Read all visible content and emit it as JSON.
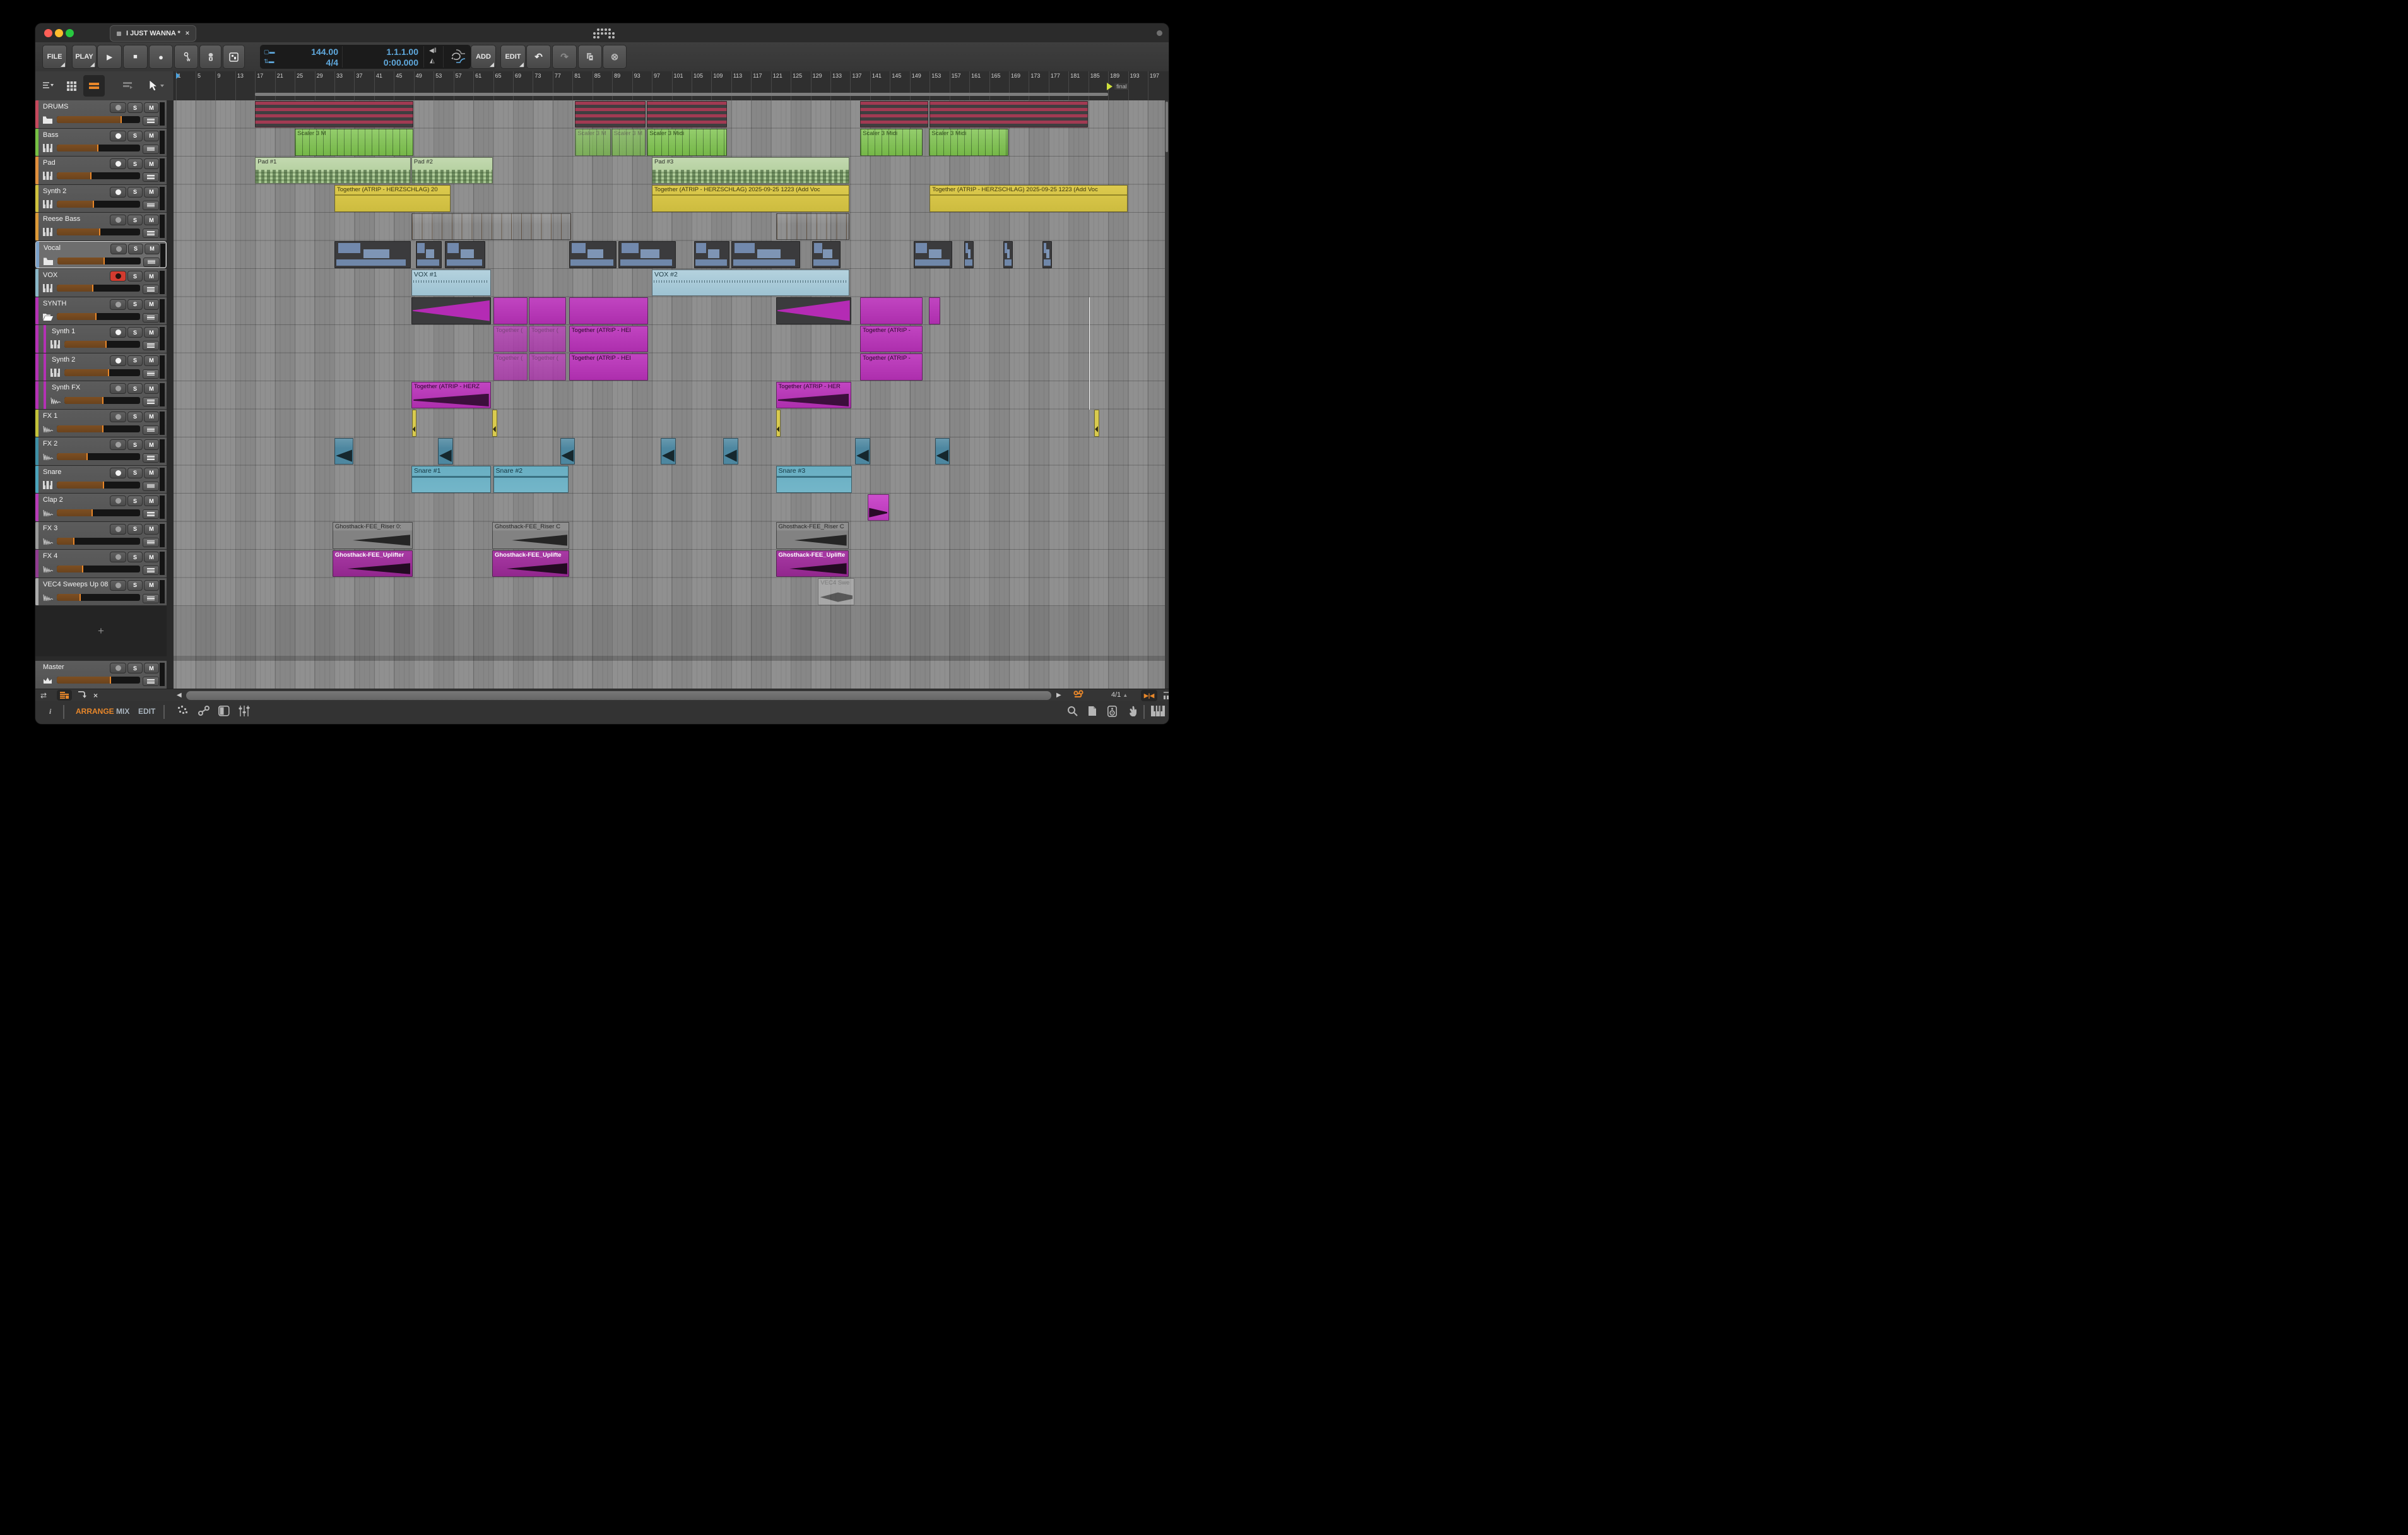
{
  "window": {
    "title": "I JUST WANNA *",
    "close_glyph": "×"
  },
  "transport": {
    "file": "FILE",
    "play": "PLAY",
    "add": "ADD",
    "edit": "EDIT",
    "tempo": "144.00",
    "time_signature": "4/4",
    "position": "1.1.1.00",
    "time": "0:00.000",
    "icon_buttons": [
      "play-icon",
      "stop-icon",
      "record-icon",
      "automation-write-icon",
      "metronome-icon",
      "punch-icon",
      "undo-icon",
      "redo-icon",
      "duplicate-icon",
      "delete-icon",
      "loop-icon"
    ]
  },
  "header_tools": {
    "icons": [
      "track-list-icon",
      "grid-view-icon",
      "arrange-lanes-icon",
      "layers-icon",
      "pointer-tool-icon"
    ]
  },
  "ruler": {
    "numbers": [
      1,
      5,
      9,
      13,
      17,
      21,
      25,
      29,
      33,
      37,
      41,
      45,
      49,
      53,
      57,
      61,
      65,
      69,
      73,
      77,
      81,
      85,
      89,
      93,
      97,
      101,
      105,
      109,
      113,
      117,
      121,
      125,
      129,
      133,
      137,
      141,
      145,
      149,
      153,
      157,
      161,
      165,
      169,
      173,
      177,
      181,
      185,
      189,
      193,
      197
    ],
    "marker": {
      "bar": 189,
      "label": "final"
    },
    "loop": {
      "from": 17,
      "to": 189
    },
    "playhead_bar": 1
  },
  "tracks": [
    {
      "name": "DRUMS",
      "color": "#c4485c",
      "icon": "folder",
      "rec": "off",
      "vol": 0.78
    },
    {
      "name": "Bass",
      "color": "#76c043",
      "icon": "keys",
      "rec": "on",
      "vol": 0.5
    },
    {
      "name": "Pad",
      "color": "#e08f3c",
      "icon": "keys",
      "rec": "on",
      "vol": 0.42
    },
    {
      "name": "Synth 2",
      "color": "#cfc13d",
      "icon": "keys",
      "rec": "on",
      "vol": 0.45
    },
    {
      "name": "Reese Bass",
      "color": "#dc9938",
      "icon": "keys",
      "rec": "off",
      "vol": 0.52
    },
    {
      "name": "Vocal",
      "color": "#7aa0c8",
      "icon": "folder",
      "rec": "off",
      "vol": 0.57,
      "selected": true
    },
    {
      "name": "VOX",
      "color": "#8ab7c7",
      "icon": "keys",
      "rec": "armed",
      "vol": 0.44
    },
    {
      "name": "SYNTH",
      "color": "#b431b4",
      "icon": "folder-open",
      "rec": "off",
      "vol": 0.48
    },
    {
      "name": "Synth 1",
      "color": "#b431b4",
      "icon": "keys",
      "rec": "on",
      "vol": 0.56,
      "child": true
    },
    {
      "name": "Synth 2",
      "color": "#b431b4",
      "icon": "keys",
      "rec": "on",
      "vol": 0.59,
      "child": true
    },
    {
      "name": "Synth FX",
      "color": "#b431b4",
      "icon": "wave",
      "rec": "off",
      "vol": 0.52,
      "child": true
    },
    {
      "name": "FX 1",
      "color": "#c2c23a",
      "icon": "wave",
      "rec": "off",
      "vol": 0.56
    },
    {
      "name": "FX 2",
      "color": "#3e8fa5",
      "icon": "wave",
      "rec": "off",
      "vol": 0.37
    },
    {
      "name": "Snare",
      "color": "#4ba3bb",
      "icon": "keys",
      "rec": "on",
      "vol": 0.57
    },
    {
      "name": "Clap 2",
      "color": "#b63bb6",
      "icon": "wave",
      "rec": "off",
      "vol": 0.43
    },
    {
      "name": "FX 3",
      "color": "#9a9a9a",
      "icon": "wave",
      "rec": "off",
      "vol": 0.21
    },
    {
      "name": "FX 4",
      "color": "#8f3b8f",
      "icon": "wave",
      "rec": "off",
      "vol": 0.32
    },
    {
      "name": "VEC4 Sweeps Up 08",
      "color": "#ababab",
      "icon": "wave",
      "rec": "off",
      "vol": 0.29
    }
  ],
  "master": {
    "name": "Master",
    "icon": "crown",
    "rec": "off",
    "vol": 0.65
  },
  "add_track_label": "+",
  "clips": [
    {
      "t": 0,
      "s": 17,
      "e": 49,
      "ty": "drums"
    },
    {
      "t": 0,
      "s": 81.5,
      "e": 95.8,
      "ty": "drums"
    },
    {
      "t": 0,
      "s": 96,
      "e": 112.3,
      "ty": "drums"
    },
    {
      "t": 0,
      "s": 139,
      "e": 152.8,
      "ty": "drums"
    },
    {
      "t": 0,
      "s": 153,
      "e": 185,
      "ty": "drums"
    },
    {
      "t": 1,
      "s": 25,
      "e": 49,
      "ty": "green",
      "l": "Scaler 3 M"
    },
    {
      "t": 1,
      "s": 81.5,
      "e": 88.8,
      "ty": "green",
      "l": "Scaler 3 M",
      "dim": true
    },
    {
      "t": 1,
      "s": 88.8,
      "e": 95.8,
      "ty": "green",
      "l": "Scaler 3 M",
      "dim": true
    },
    {
      "t": 1,
      "s": 96,
      "e": 112.3,
      "ty": "green",
      "l": "Scaler 3 Midi"
    },
    {
      "t": 1,
      "s": 139,
      "e": 151.7,
      "ty": "green",
      "l": "Scaler 3 Midi"
    },
    {
      "t": 1,
      "s": 152.9,
      "e": 169,
      "ty": "green",
      "l": "Scaler 3 Midi"
    },
    {
      "t": 2,
      "s": 17,
      "e": 48.5,
      "ty": "pad",
      "l": "Pad #1"
    },
    {
      "t": 2,
      "s": 48.5,
      "e": 65,
      "ty": "pad",
      "l": "Pad #2"
    },
    {
      "t": 2,
      "s": 97,
      "e": 137,
      "ty": "pad",
      "l": "Pad #3"
    },
    {
      "t": 3,
      "s": 33,
      "e": 56.5,
      "ty": "yellow",
      "l": "Together (ATRIP - HERZSCHLAG) 20"
    },
    {
      "t": 3,
      "s": 97,
      "e": 137,
      "ty": "yellow",
      "l": "Together (ATRIP - HERZSCHLAG) 2025-09-25 1223 (Add Voc"
    },
    {
      "t": 3,
      "s": 153,
      "e": 193,
      "ty": "yellow",
      "l": "Together (ATRIP - HERZSCHLAG) 2025-09-25 1223 (Add Voc"
    },
    {
      "t": 4,
      "s": 48.5,
      "e": 80.8,
      "ty": "oseg"
    },
    {
      "t": 4,
      "s": 122,
      "e": 137,
      "ty": "oseg"
    },
    {
      "t": 5,
      "s": 33,
      "e": 48.5,
      "ty": "vocal"
    },
    {
      "t": 5,
      "s": 49.4,
      "e": 54.7,
      "ty": "vocal"
    },
    {
      "t": 5,
      "s": 55.3,
      "e": 63.5,
      "ty": "vocal"
    },
    {
      "t": 5,
      "s": 80.3,
      "e": 90,
      "ty": "vocal"
    },
    {
      "t": 5,
      "s": 90.3,
      "e": 102,
      "ty": "vocal"
    },
    {
      "t": 5,
      "s": 105.5,
      "e": 112.8,
      "ty": "vocal"
    },
    {
      "t": 5,
      "s": 113,
      "e": 127,
      "ty": "vocal"
    },
    {
      "t": 5,
      "s": 129.3,
      "e": 135.2,
      "ty": "vocal"
    },
    {
      "t": 5,
      "s": 149.8,
      "e": 157.7,
      "ty": "vocal"
    },
    {
      "t": 5,
      "s": 160,
      "e": 162,
      "ty": "vocal"
    },
    {
      "t": 5,
      "s": 167.9,
      "e": 169.9,
      "ty": "vocal"
    },
    {
      "t": 5,
      "s": 175.8,
      "e": 177.8,
      "ty": "vocal"
    },
    {
      "t": 6,
      "s": 48.5,
      "e": 64.7,
      "ty": "vox",
      "l": "VOX  #1"
    },
    {
      "t": 6,
      "s": 97,
      "e": 137,
      "ty": "vox",
      "l": "VOX  #2"
    },
    {
      "t": 7,
      "s": 48.5,
      "e": 64.7,
      "ty": "swell"
    },
    {
      "t": 7,
      "s": 65,
      "e": 72,
      "ty": "mag"
    },
    {
      "t": 7,
      "s": 72.2,
      "e": 79.8,
      "ty": "mag"
    },
    {
      "t": 7,
      "s": 80.3,
      "e": 96.3,
      "ty": "mag"
    },
    {
      "t": 7,
      "s": 122,
      "e": 137.3,
      "ty": "swell"
    },
    {
      "t": 7,
      "s": 139,
      "e": 151.7,
      "ty": "mag"
    },
    {
      "t": 7,
      "s": 152.9,
      "e": 155.3,
      "ty": "mag"
    },
    {
      "t": 8,
      "s": 65,
      "e": 72,
      "ty": "mag",
      "l": "Together (",
      "dim": true
    },
    {
      "t": 8,
      "s": 72.2,
      "e": 79.8,
      "ty": "mag",
      "l": "Together (",
      "dim": true
    },
    {
      "t": 8,
      "s": 80.3,
      "e": 96.3,
      "ty": "mag",
      "l": "Together (ATRIP - HEI"
    },
    {
      "t": 8,
      "s": 139,
      "e": 151.7,
      "ty": "mag",
      "l": "Together (ATRIP -"
    },
    {
      "t": 9,
      "s": 65,
      "e": 72,
      "ty": "mag",
      "l": "Together (",
      "dim": true
    },
    {
      "t": 9,
      "s": 72.2,
      "e": 79.8,
      "ty": "mag",
      "l": "Together (",
      "dim": true
    },
    {
      "t": 9,
      "s": 80.3,
      "e": 96.3,
      "ty": "mag",
      "l": "Together (ATRIP - HEI"
    },
    {
      "t": 9,
      "s": 139,
      "e": 151.7,
      "ty": "mag",
      "l": "Together (ATRIP -"
    },
    {
      "t": 10,
      "s": 48.5,
      "e": 64.7,
      "ty": "magswell",
      "l": "Together (ATRIP - HERZ"
    },
    {
      "t": 10,
      "s": 122,
      "e": 137.3,
      "ty": "magswell",
      "l": "Together (ATRIP - HER"
    },
    {
      "t": 11,
      "s": 48.6,
      "e": 49.7,
      "ty": "fx1"
    },
    {
      "t": 11,
      "s": 64.8,
      "e": 65.9,
      "ty": "fx1"
    },
    {
      "t": 11,
      "s": 122,
      "e": 123.1,
      "ty": "fx1"
    },
    {
      "t": 11,
      "s": 186.2,
      "e": 187.3,
      "ty": "fx1"
    },
    {
      "t": 12,
      "s": 33,
      "e": 37,
      "ty": "fx2"
    },
    {
      "t": 12,
      "s": 53.9,
      "e": 57,
      "ty": "fx2"
    },
    {
      "t": 12,
      "s": 78.5,
      "e": 81.6,
      "ty": "fx2"
    },
    {
      "t": 12,
      "s": 98.8,
      "e": 101.9,
      "ty": "fx2"
    },
    {
      "t": 12,
      "s": 111.4,
      "e": 114.5,
      "ty": "fx2"
    },
    {
      "t": 12,
      "s": 138,
      "e": 141.1,
      "ty": "fx2"
    },
    {
      "t": 12,
      "s": 154.1,
      "e": 157.2,
      "ty": "fx2"
    },
    {
      "t": 13,
      "s": 48.5,
      "e": 64.7,
      "ty": "snare",
      "l": "Snare  #1"
    },
    {
      "t": 13,
      "s": 65,
      "e": 80.3,
      "ty": "snare",
      "l": "Snare  #2"
    },
    {
      "t": 13,
      "s": 122,
      "e": 137.5,
      "ty": "snare",
      "l": "Snare  #3"
    },
    {
      "t": 14,
      "s": 140.5,
      "e": 145,
      "ty": "clap"
    },
    {
      "t": 15,
      "s": 32.6,
      "e": 48.9,
      "ty": "riser",
      "l": "Ghosthack-FEE_Riser 0:"
    },
    {
      "t": 15,
      "s": 64.8,
      "e": 80.5,
      "ty": "riser",
      "l": "Ghosthack-FEE_Riser C"
    },
    {
      "t": 15,
      "s": 122,
      "e": 136.8,
      "ty": "riser",
      "l": "Ghosthack-FEE_Riser C"
    },
    {
      "t": 16,
      "s": 32.6,
      "e": 48.9,
      "ty": "uplift",
      "l": "Ghosthack-FEE_Uplifter"
    },
    {
      "t": 16,
      "s": 64.8,
      "e": 80.5,
      "ty": "uplift",
      "l": "Ghosthack-FEE_Uplifte"
    },
    {
      "t": 16,
      "s": 122,
      "e": 136.8,
      "ty": "uplift",
      "l": "Ghosthack-FEE_Uplifte"
    },
    {
      "t": 17,
      "s": 130.5,
      "e": 138,
      "ty": "vec4",
      "l": "VEC4 Swe"
    }
  ],
  "scrollbar": {
    "zoom_ratio": "4/1",
    "icons": [
      "scroll-left-icon",
      "scroll-right-icon",
      "follow-playhead-icon",
      "snap-icon",
      "zoom-to-fit-icon",
      "swap-icon",
      "layout-list-icon",
      "jump-icon",
      "close-icon"
    ]
  },
  "bottom_bar": {
    "info": "i",
    "arrange": "ARRANGE",
    "mix": "MIX",
    "edit": "EDIT",
    "left_icons": [
      "automation-icon",
      "link-icon",
      "panel-icon",
      "mixer-sliders-icon"
    ],
    "right_icons": [
      "search-icon",
      "file-icon",
      "speaker-icon",
      "hand-icon",
      "piano-icon"
    ]
  },
  "colors": {
    "accent": "#e8872a",
    "lcd_text": "#5fa8dc",
    "record_armed": "#d23b2f",
    "clip_yellow": "#d6c244",
    "clip_green": "#7cc24c",
    "clip_pad": "#b2cf9e",
    "clip_orange": "#e2923b",
    "clip_magenta": "#bb3abb",
    "clip_vox": "#a7cad8",
    "clip_snare": "#6db0c4",
    "clip_drums_stripe": "#a13a52",
    "clip_vocal_block": "#7289ad",
    "clip_uplifter": "#a0309c",
    "clip_riser": "#858585"
  },
  "icons": {
    "play": "▶",
    "stop": "■",
    "record": "●",
    "undo": "↶",
    "redo": "↷",
    "delete": "⊗",
    "caret-down": "▾",
    "caret-up": "▲",
    "scroll-left": "◀",
    "scroll-right": "▶",
    "swap": "⇄",
    "close": "×",
    "snap": "▶|◀",
    "add_track": "+"
  }
}
